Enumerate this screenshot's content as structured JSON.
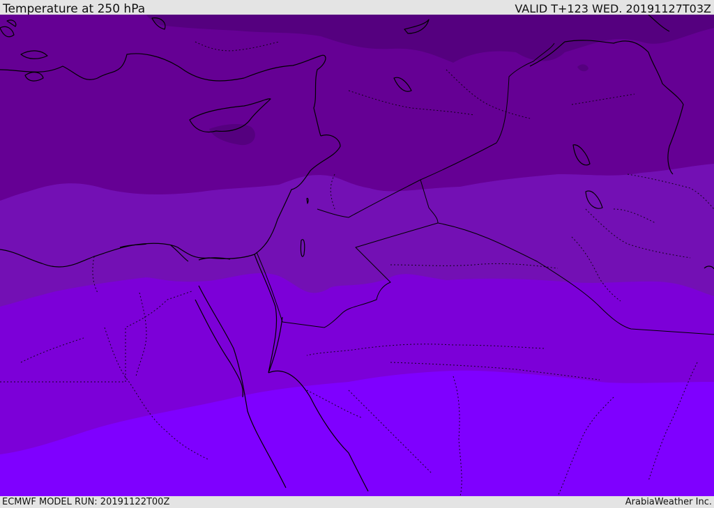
{
  "header": {
    "title": "Temperature at 250 hPa",
    "valid": "VALID T+123 WED. 20191127T03Z"
  },
  "footer": {
    "model_run": "ECMWF MODEL RUN: 20191122T00Z",
    "credit": "ArabiaWeather Inc."
  },
  "map": {
    "variable": "Temperature",
    "level": "250 hPa",
    "temperature_bands": [
      {
        "rank": 1,
        "color": "#55007f",
        "note": "coldest band (northern edge)"
      },
      {
        "rank": 2,
        "color": "#650094"
      },
      {
        "rank": 3,
        "color": "#7310b4"
      },
      {
        "rank": 4,
        "color": "#7c00d8"
      },
      {
        "rank": 5,
        "color": "#7f00ff",
        "note": "warmest band (south)"
      }
    ],
    "coastline_color": "#000000",
    "border_style": "dotted"
  }
}
